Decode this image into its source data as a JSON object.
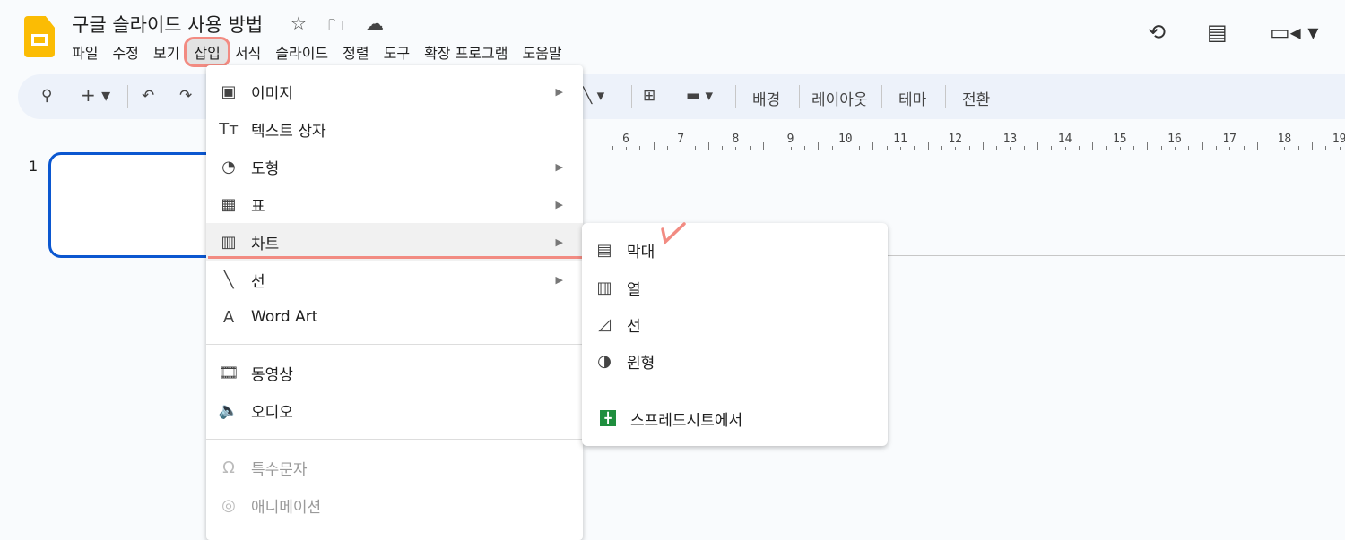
{
  "doc": {
    "title": "구글 슬라이드 사용 방법"
  },
  "menubar": [
    "파일",
    "수정",
    "보기",
    "삽입",
    "서식",
    "슬라이드",
    "정렬",
    "도구",
    "확장 프로그램",
    "도움말"
  ],
  "active_menu": "삽입",
  "toolbar": {
    "background": "배경",
    "layout": "레이아웃",
    "theme": "테마",
    "transition": "전환"
  },
  "ruler": [
    6,
    7,
    8,
    9,
    10,
    11,
    12,
    13,
    14,
    15,
    16,
    17,
    18,
    19
  ],
  "slide_number": "1",
  "insert_menu": [
    {
      "label": "이미지",
      "icon": "image-icon",
      "submenu": true
    },
    {
      "label": "텍스트 상자",
      "icon": "text-box-icon",
      "submenu": false
    },
    {
      "label": "도형",
      "icon": "shape-icon",
      "submenu": true
    },
    {
      "label": "표",
      "icon": "table-icon",
      "submenu": true
    },
    {
      "label": "차트",
      "icon": "chart-icon",
      "submenu": true
    },
    {
      "label": "선",
      "icon": "line-icon",
      "submenu": true
    },
    {
      "label": "Word Art",
      "icon": "word-art-icon",
      "submenu": false
    },
    {
      "label": "동영상",
      "icon": "video-icon",
      "submenu": false
    },
    {
      "label": "오디오",
      "icon": "audio-icon",
      "submenu": false
    },
    {
      "label": "특수문자",
      "icon": "omega-icon",
      "submenu": false,
      "disabled": true
    },
    {
      "label": "애니메이션",
      "icon": "animation-icon",
      "submenu": false,
      "disabled": true
    }
  ],
  "chart_submenu": [
    {
      "label": "막대",
      "icon": "bar-chart-icon"
    },
    {
      "label": "열",
      "icon": "column-chart-icon"
    },
    {
      "label": "선",
      "icon": "line-chart-icon"
    },
    {
      "label": "원형",
      "icon": "pie-chart-icon"
    },
    {
      "label": "스프레드시트에서",
      "icon": "sheets-icon"
    }
  ],
  "colors": {
    "accent": "#0b57d0",
    "annotation": "#f28b82",
    "sheets": "#1e8e3e",
    "logo": "#fbbc04"
  }
}
